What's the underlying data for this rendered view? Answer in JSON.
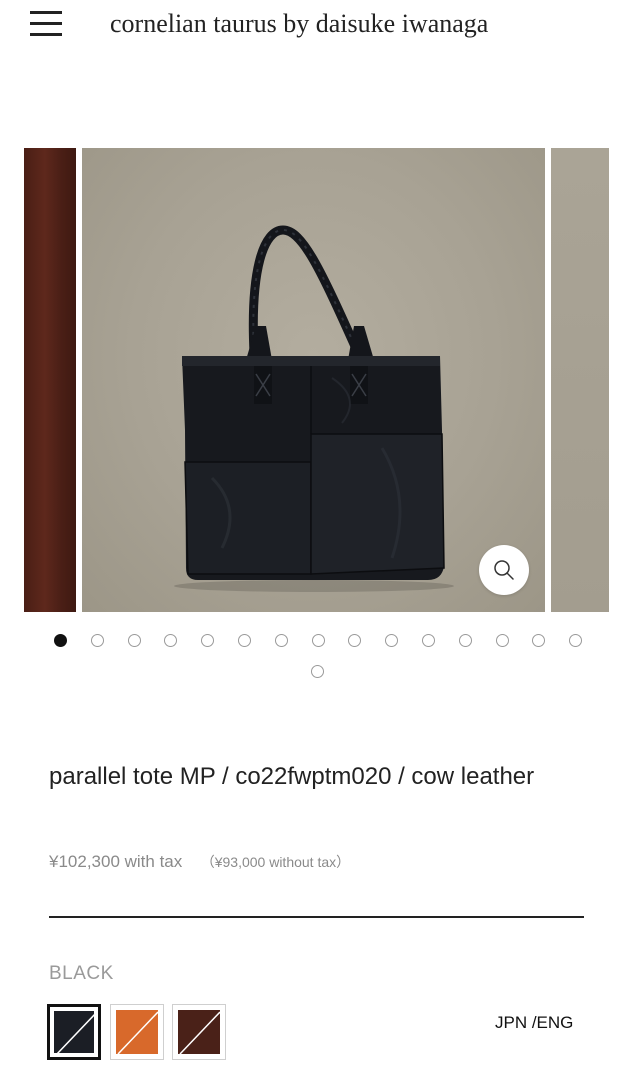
{
  "header": {
    "brand": "cornelian taurus by daisuke iwanaga",
    "menu_icon": "hamburger-menu-icon"
  },
  "gallery": {
    "current_slide": 1,
    "total_slides": 16,
    "zoom_icon": "magnifier-icon",
    "colors": {
      "background": "#a8a294",
      "bag": "#15171c",
      "left_slide": "#4f2118"
    }
  },
  "product": {
    "title": "parallel tote MP / co22fwptm020 / cow leather",
    "price_with_tax": "¥102,300 with tax",
    "price_without_tax": "（¥93,000 without tax）"
  },
  "color_selector": {
    "selected_label": "BLACK",
    "options": [
      {
        "name": "black",
        "color": "#1b1e25",
        "selected": true
      },
      {
        "name": "orange",
        "color": "#d8692b",
        "selected": false
      },
      {
        "name": "brown",
        "color": "#4a2118",
        "selected": false
      }
    ]
  },
  "footer": {
    "language_switch": "JPN /ENG"
  }
}
